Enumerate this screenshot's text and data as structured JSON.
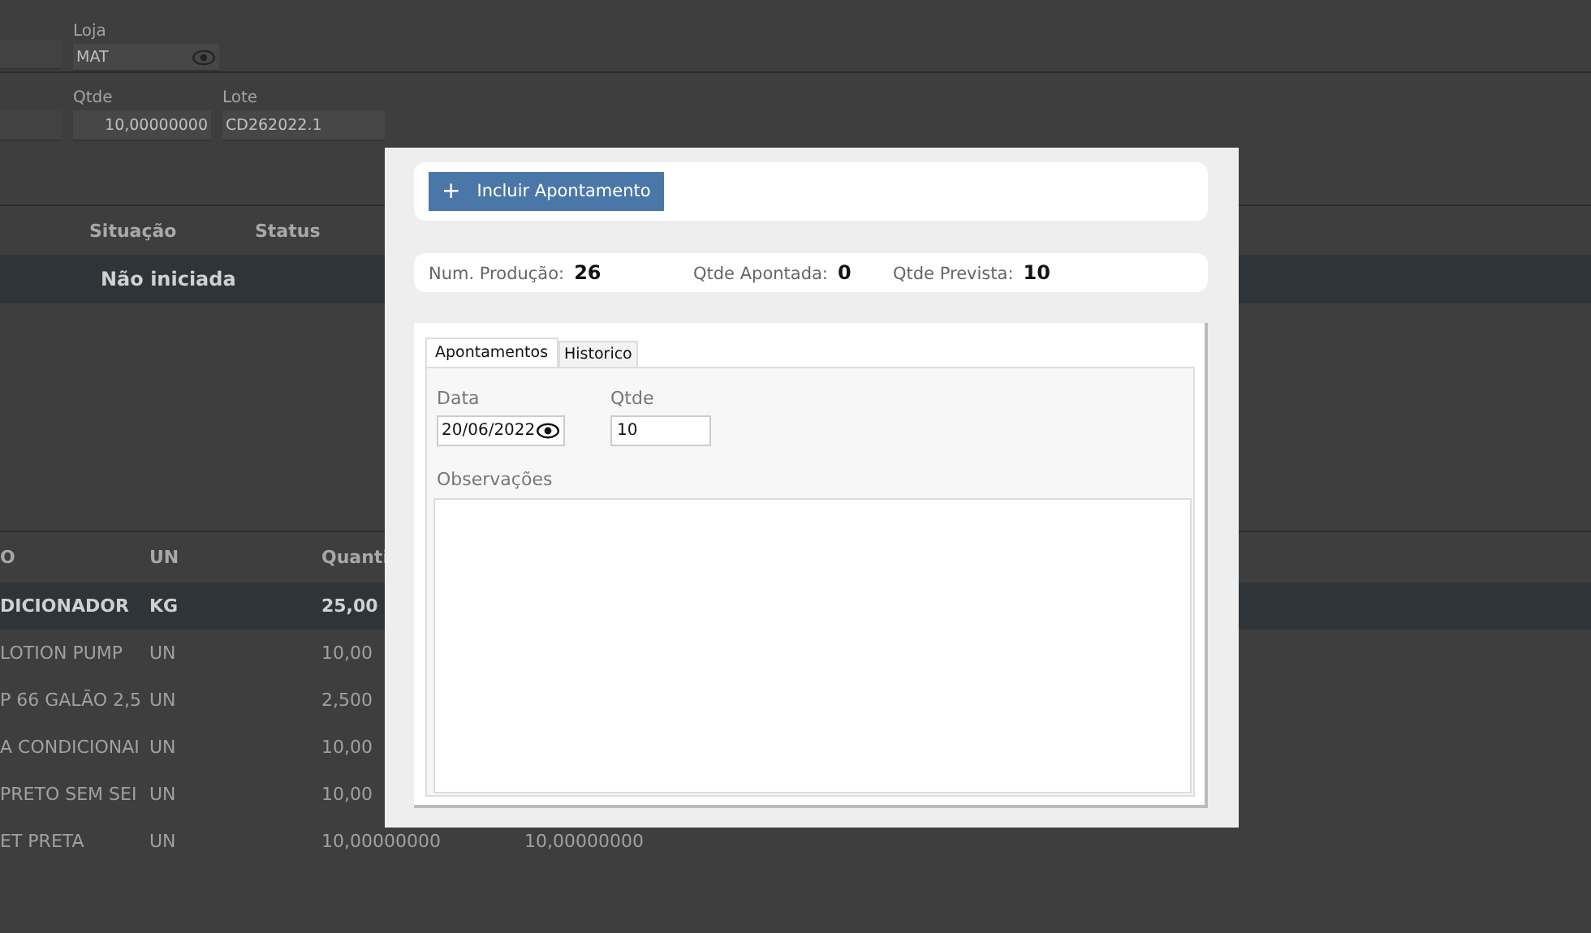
{
  "form": {
    "loja": {
      "label": "Loja",
      "value": "MAT"
    },
    "qtde": {
      "label": "Qtde",
      "value": "10,00000000"
    },
    "lote": {
      "label": "Lote",
      "value": "CD262022.1"
    }
  },
  "status_table": {
    "columns": [
      "Situação",
      "Status"
    ],
    "rows": [
      {
        "selected": true,
        "cells": [
          "Não iniciada"
        ]
      }
    ]
  },
  "items_table": {
    "columns": [
      "O",
      "UN",
      "Quanti"
    ],
    "rows": [
      {
        "selected": true,
        "cells": [
          "DICIONADOR",
          "KG",
          "25,00"
        ]
      },
      {
        "selected": false,
        "cells": [
          "LOTION PUMP",
          "UN",
          "10,00"
        ]
      },
      {
        "selected": false,
        "cells": [
          "P 66 GALÃO 2,5",
          "UN",
          "2,500"
        ]
      },
      {
        "selected": false,
        "cells": [
          "A CONDICIONAI",
          "UN",
          "10,00"
        ]
      },
      {
        "selected": false,
        "cells": [
          "PRETO SEM SEI",
          "UN",
          "10,00"
        ]
      },
      {
        "selected": false,
        "cells": [
          "ET PRETA",
          "UN",
          "10,00000000",
          "10,00000000"
        ]
      }
    ]
  },
  "dialog": {
    "add_icon": "+",
    "add_button": "Incluir Apontamento",
    "summary": [
      {
        "label": "Num. Produção:",
        "value": "26"
      },
      {
        "label": "Qtde Apontada:",
        "value": "0"
      },
      {
        "label": "Qtde Prevista:",
        "value": "10"
      }
    ],
    "tabs": [
      {
        "label": "Apontamentos",
        "selected": true
      },
      {
        "label": "Historico",
        "selected": false
      }
    ],
    "date": {
      "label": "Data",
      "value": "20/06/2022"
    },
    "qtde": {
      "label": "Qtde",
      "value": "10"
    },
    "notes": {
      "label": "Observações"
    }
  }
}
